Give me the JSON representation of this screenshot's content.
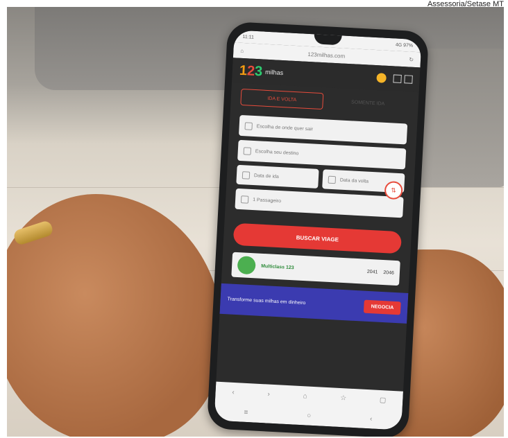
{
  "credit": "Assessoria/Setase MT",
  "phone": {
    "status_time": "11:11",
    "status_right": "4G 97%",
    "url": "123milhas.com",
    "logo_digits": [
      "1",
      "2",
      "3"
    ],
    "logo_text": "milhas",
    "tabs": [
      {
        "label": "IDA E VOLTA",
        "active": true
      },
      {
        "label": "SOMENTE IDA",
        "active": false
      }
    ],
    "origin_placeholder": "Escolha de onde quer sair",
    "destination_placeholder": "Escolha seu destino",
    "swap_label": "⇅",
    "date_out": "Data de ida",
    "date_back": "Data da volta",
    "passengers": "1 Passageiro",
    "search_button": "BUSCAR VIAGE",
    "promo_name": "Multiclass 123",
    "promo_val1": "2041",
    "promo_val2": "2046",
    "banner_text": "Transforme suas milhas em dinheiro",
    "banner_button": "NEGOCIA"
  },
  "colors": {
    "accent": "#e53935",
    "logo_orange": "#f39c12",
    "logo_green": "#2ecc71",
    "banner": "#3b3bb0"
  }
}
